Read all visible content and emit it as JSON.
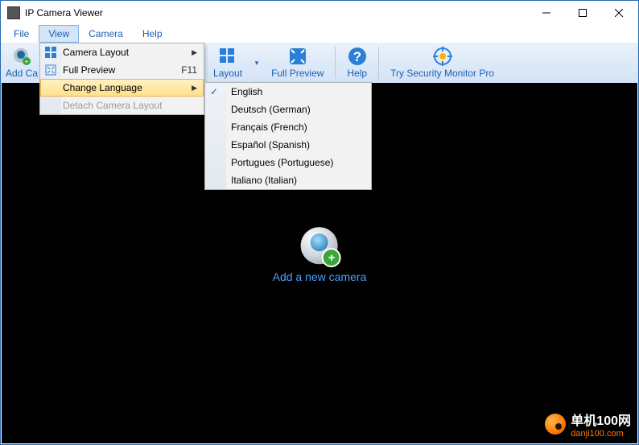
{
  "window": {
    "title": "IP Camera Viewer"
  },
  "menubar": {
    "file": "File",
    "view": "View",
    "camera": "Camera",
    "help": "Help"
  },
  "toolbar": {
    "add_camera": "Add Ca",
    "layout": "Layout",
    "full_preview": "Full Preview",
    "help": "Help",
    "try_pro": "Try Security Monitor Pro"
  },
  "view_menu": {
    "camera_layout": "Camera Layout",
    "full_preview": "Full Preview",
    "full_preview_shortcut": "F11",
    "change_language": "Change Language",
    "detach": "Detach Camera Layout"
  },
  "languages": [
    {
      "label": "English",
      "checked": true
    },
    {
      "label": "Deutsch (German)",
      "checked": false
    },
    {
      "label": "Français (French)",
      "checked": false
    },
    {
      "label": "Español (Spanish)",
      "checked": false
    },
    {
      "label": "Portugues (Portuguese)",
      "checked": false
    },
    {
      "label": "Italiano (Italian)",
      "checked": false
    }
  ],
  "viewport": {
    "add_camera_link": "Add a new camera"
  },
  "watermark": {
    "cn": "单机100网",
    "url": "danji100.com"
  }
}
